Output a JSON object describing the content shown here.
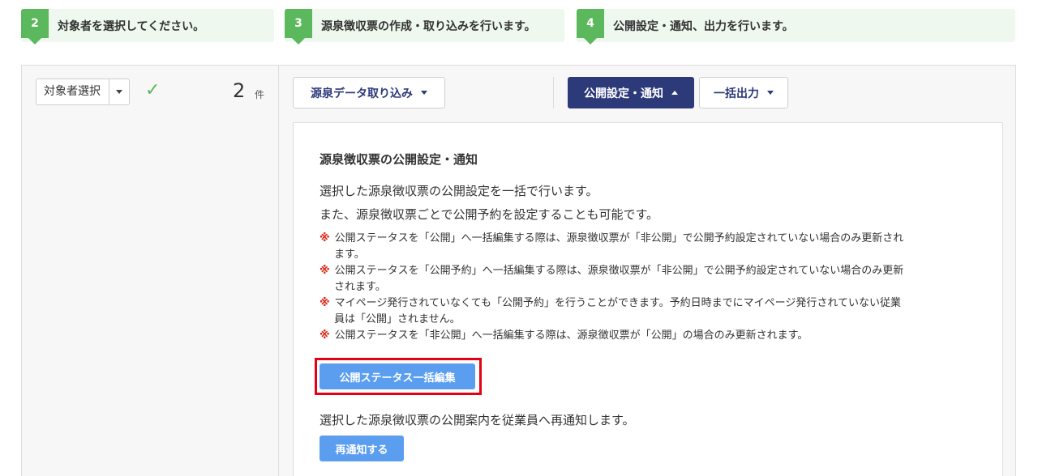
{
  "steps": [
    {
      "num": "2",
      "label": "対象者を選択してください。"
    },
    {
      "num": "3",
      "label": "源泉徴収票の作成・取り込みを行います。"
    },
    {
      "num": "4",
      "label": "公開設定・通知、出力を行います。"
    }
  ],
  "left": {
    "select_label": "対象者選択",
    "count": "2",
    "count_unit": "件"
  },
  "toolbar": {
    "import_label": "源泉データ取り込み",
    "publish_label": "公開設定・通知",
    "bulk_output_label": "一括出力"
  },
  "panel": {
    "title": "源泉徴収票の公開設定・通知",
    "desc1": "選択した源泉徴収票の公開設定を一括で行います。",
    "desc2": "また、源泉徴収票ごとで公開予約を設定することも可能です。",
    "note_mark": "※",
    "notes": [
      {
        "line1": "公開ステータスを「公開」へ一括編集する際は、源泉徴収票が「非公開」で公開予約設定されていない場合のみ更新され",
        "line2": "ます。"
      },
      {
        "line1": "公開ステータスを「公開予約」へ一括編集する際は、源泉徴収票が「非公開」で公開予約設定されていない場合のみ更新",
        "line2": "されます。"
      },
      {
        "line1": "マイページ発行されていなくても「公開予約」を行うことができます。予約日時までにマイページ発行されていない従業",
        "line2": "員は「公開」されません。"
      },
      {
        "line1": "公開ステータスを「非公開」へ一括編集する際は、源泉徴収票が「公開」の場合のみ更新されます。",
        "line2": ""
      }
    ],
    "status_button": "公開ステータス一括編集",
    "desc3": "選択した源泉徴収票の公開案内を従業員へ再通知します。",
    "notify_button": "再通知する"
  }
}
